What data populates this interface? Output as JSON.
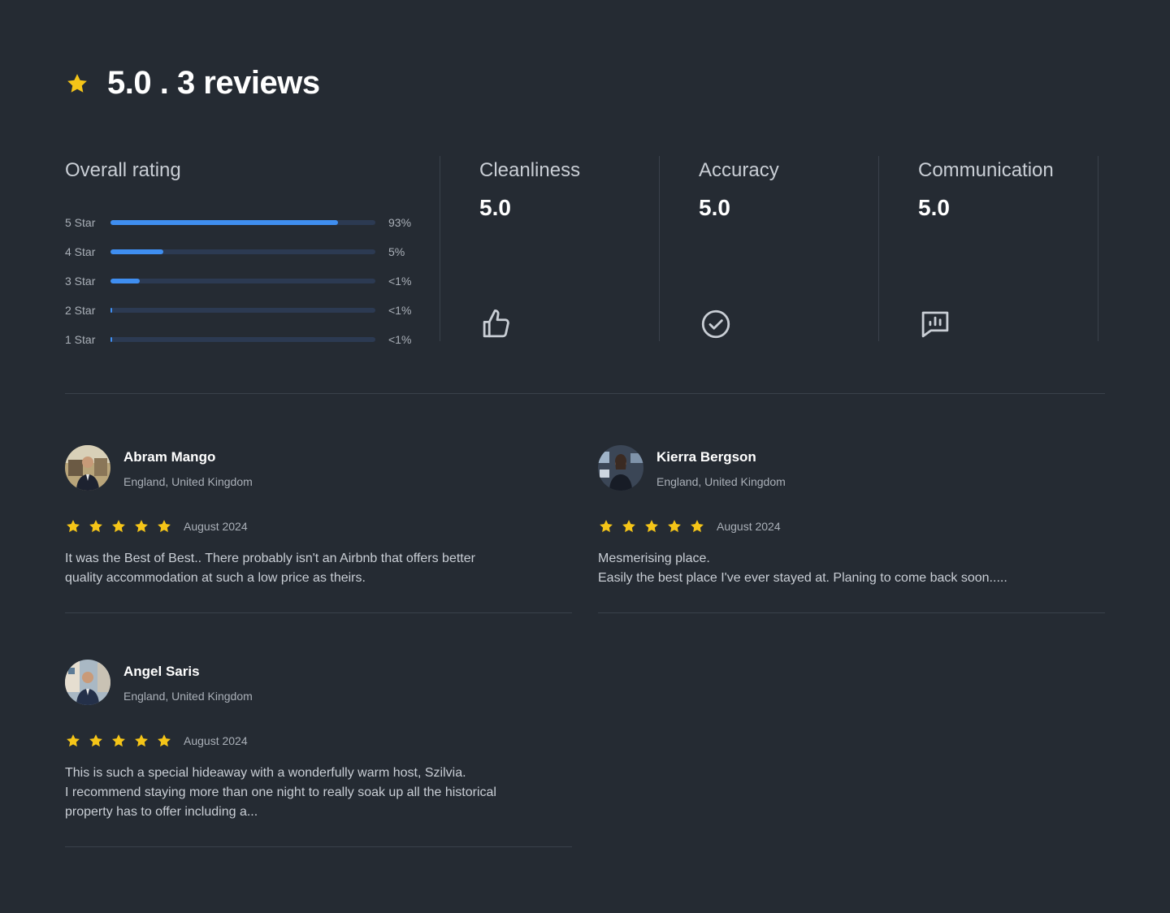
{
  "header": {
    "title": "5.0 . 3 reviews",
    "star_icon": "star-icon",
    "accent": "#f5c518"
  },
  "overall": {
    "title": "Overall rating",
    "bar_color": "#3f8ef0",
    "rows": [
      {
        "label": "5 Star",
        "pct": "93%",
        "fill": 0.86
      },
      {
        "label": "4 Star",
        "pct": "5%",
        "fill": 0.2
      },
      {
        "label": "3 Star",
        "pct": "<1%",
        "fill": 0.11
      },
      {
        "label": "2 Star",
        "pct": "<1%",
        "fill": 0.006
      },
      {
        "label": "1 Star",
        "pct": "<1%",
        "fill": 0.006
      }
    ]
  },
  "metrics": [
    {
      "title": "Cleanliness",
      "value": "5.0",
      "icon": "thumbs-up-icon"
    },
    {
      "title": "Accuracy",
      "value": "5.0",
      "icon": "check-circle-icon"
    },
    {
      "title": "Communication",
      "value": "5.0",
      "icon": "message-chart-icon"
    }
  ],
  "reviews": [
    {
      "name": "Abram Mango",
      "location": "England, United Kingdom",
      "stars": 5,
      "date": "August 2024",
      "text": [
        "It was the Best of Best.. There probably isn't an Airbnb that offers better quality accommodation at such a low price as theirs."
      ]
    },
    {
      "name": "Kierra Bergson",
      "location": "England, United Kingdom",
      "stars": 5,
      "date": "August 2024",
      "text": [
        "Mesmerising place.",
        "Easily the best place I've ever stayed at. Planing to come back soon....."
      ]
    },
    {
      "name": "Angel Saris",
      "location": "England, United Kingdom",
      "stars": 5,
      "date": "August 2024",
      "text": [
        "This is such a special hideaway with a wonderfully warm host, Szilvia.",
        "I recommend staying more than one night to really soak up all the historical property has to offer including a..."
      ]
    }
  ]
}
